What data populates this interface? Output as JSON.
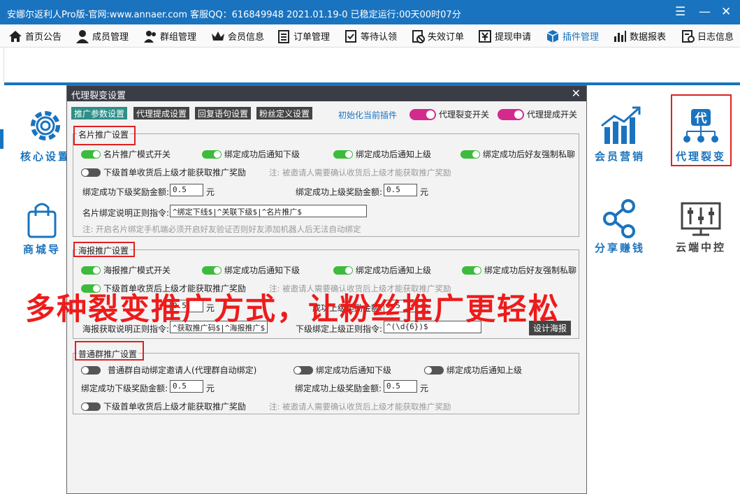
{
  "titlebar": {
    "title": "安娜尔返利人Pro版-官网:www.annaer.com 客服QQ：616849948   2021.01.19-0   已稳定运行:00天00时07分",
    "menu_icon": "hamburger-icon",
    "minimize": "—",
    "close": "✕"
  },
  "menubar": {
    "items": [
      {
        "label": "首页公告",
        "icon": "home-icon"
      },
      {
        "label": "成员管理",
        "icon": "user-icon"
      },
      {
        "label": "群组管理",
        "icon": "group-icon"
      },
      {
        "label": "会员信息",
        "icon": "crown-icon"
      },
      {
        "label": "订单管理",
        "icon": "list-icon"
      },
      {
        "label": "等待认领",
        "icon": "claim-icon"
      },
      {
        "label": "失效订单",
        "icon": "invalid-icon"
      },
      {
        "label": "提现申请",
        "icon": "withdraw-icon"
      },
      {
        "label": "插件管理",
        "icon": "cube-icon"
      },
      {
        "label": "数据报表",
        "icon": "bar-chart-icon"
      },
      {
        "label": "日志信息",
        "icon": "log-icon"
      }
    ]
  },
  "tiles": {
    "core_settings": "核心设置",
    "mall_nav": "商城导",
    "member_marketing": "会员营销",
    "agent_fission": "代理裂变",
    "agent_fission_glyph": "代",
    "share_earn": "分享赚钱",
    "cloud_control": "云端中控"
  },
  "dialog": {
    "title": "代理裂变设置",
    "close": "✕",
    "tabs": [
      "推广参数设置",
      "代理提成设置",
      "回复语句设置",
      "粉丝定义设置"
    ],
    "init_link": "初始化当前插件",
    "toggle_fission": "代理裂变开关",
    "toggle_commission": "代理提成开关",
    "card": {
      "title": "名片推广设置",
      "mode_switch": "名片推广模式开关",
      "notify_lower": "绑定成功后通知下级",
      "notify_upper": "绑定成功后通知上级",
      "friend_private": "绑定成功后好友强制私聊",
      "first_order": "下级首单收货后上级才能获取推广奖励",
      "first_order_note": "注: 被邀请人需要确认收货后上级才能获取推广奖励",
      "lower_reward_label": "绑定成功下级奖励金额:",
      "lower_reward_value": "0.5",
      "upper_reward_label": "绑定成功上级奖励金额:",
      "upper_reward_value": "0.5",
      "unit": "元",
      "regex_label": "名片绑定说明正则指令:",
      "regex_value": "^绑定下线$|^关联下级$|^名片推广$",
      "bottom_note": "注: 开启名片绑定手机端必须开启好友验证否则好友添加机器人后无法自动绑定"
    },
    "poster": {
      "title": "海报推广设置",
      "mode_switch": "海报推广模式开关",
      "notify_lower": "绑定成功后通知下级",
      "notify_upper": "绑定成功后通知上级",
      "friend_private": "绑定成功后好友强制私聊",
      "first_order": "下级首单收货后上级才能获取推广奖励",
      "first_order_note": "注: 被邀请人需要确认收货后上级才能获取推广奖励",
      "lower_reward_value": "0.5",
      "upper_reward_label": "成功上级奖励金额:",
      "upper_reward_value": "0.5",
      "unit": "元",
      "regex_label": "海报获取说明正则指令:",
      "regex_value": "^获取推广码$|^海报推广$",
      "bind_regex_label": "下级绑定上级正则指令:",
      "bind_regex_value": "^(\\d{6})$",
      "design_button": "设计海报"
    },
    "group": {
      "title": "普通群推广设置",
      "auto_bind": "普通群自动绑定邀请人(代理群自动绑定)",
      "notify_lower": "绑定成功后通知下级",
      "notify_upper": "绑定成功后通知上级",
      "lower_reward_label": "绑定成功下级奖励金额:",
      "lower_reward_value": "0.5",
      "upper_reward_label": "绑定成功上级奖励金额:",
      "upper_reward_value": "0.5",
      "unit": "元",
      "first_order": "下级首单收货后上级才能获取推广奖励",
      "first_order_note": "注: 被邀请人需要确认收货后上级才能获取推广奖励"
    }
  },
  "overlay_text": "多种裂变推广方式，让粉丝推广更轻松",
  "colors": {
    "brand": "#1a73bf",
    "switch_on": "#3dbb3d",
    "switch_pink": "#d42a8d",
    "overlay": "#ee1b1b",
    "highlight": "#e02020"
  }
}
